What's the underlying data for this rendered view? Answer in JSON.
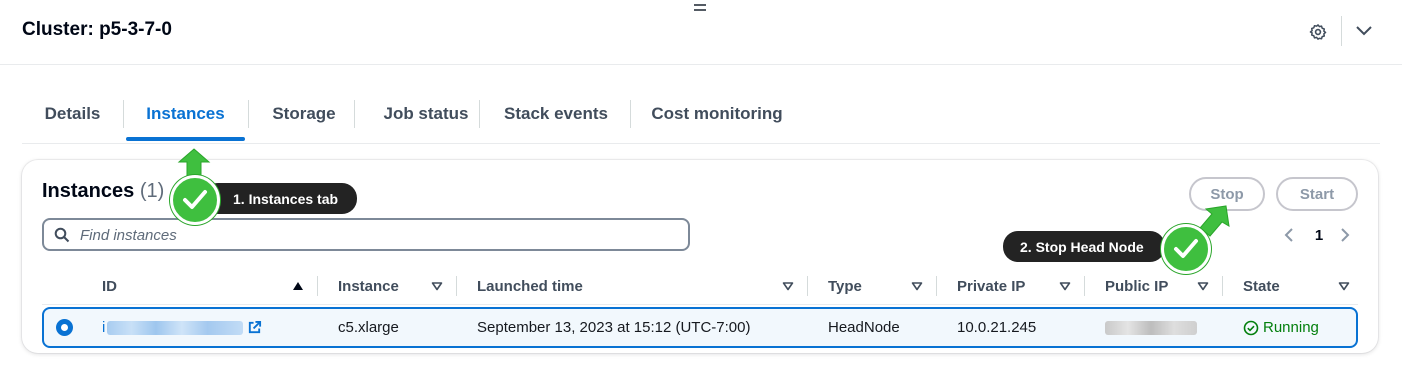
{
  "header": {
    "title": "Cluster: p5-3-7-0",
    "settings_icon": "gear-icon",
    "collapse_icon": "chevron-down-icon"
  },
  "tabs": [
    {
      "label": "Details",
      "active": false
    },
    {
      "label": "Instances",
      "active": true
    },
    {
      "label": "Storage",
      "active": false
    },
    {
      "label": "Job status",
      "active": false
    },
    {
      "label": "Stack events",
      "active": false
    },
    {
      "label": "Cost monitoring",
      "active": false
    }
  ],
  "panel": {
    "title": "Instances",
    "count": "(1)",
    "search_placeholder": "Find instances",
    "stop_label": "Stop",
    "start_label": "Start",
    "page": "1"
  },
  "table": {
    "columns": [
      "ID",
      "Instance",
      "Launched time",
      "Type",
      "Private IP",
      "Public IP",
      "State"
    ],
    "rows": [
      {
        "selected": true,
        "id_prefix": "i",
        "instance": "c5.xlarge",
        "launched": "September 13, 2023 at 15:12 (UTC-7:00)",
        "type": "HeadNode",
        "private_ip": "10.0.21.245",
        "state": "Running"
      }
    ]
  },
  "annotations": [
    {
      "label": "1. Instances tab"
    },
    {
      "label": "2. Stop Head Node"
    }
  ],
  "colors": {
    "accent": "#0972d3",
    "success": "#037f0c",
    "annotation_green": "#3fbf3f",
    "callout_bg": "#232323"
  }
}
